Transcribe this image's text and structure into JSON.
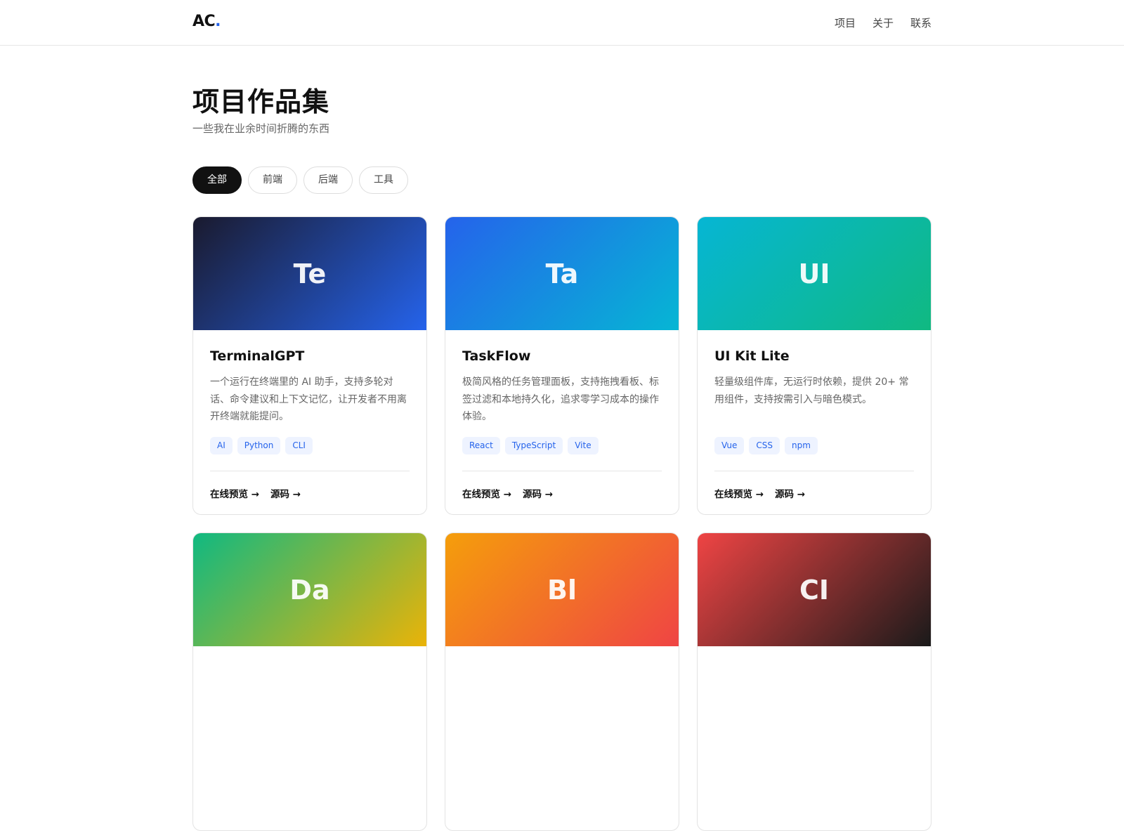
{
  "header": {
    "logo_text": "AC",
    "logo_dot": ".",
    "nav": [
      "项目",
      "关于",
      "联系"
    ]
  },
  "hero": {
    "title": "项目作品集",
    "subtitle": "一些我在业余时间折腾的东西"
  },
  "filters": {
    "items": [
      "全部",
      "前端",
      "后端",
      "工具"
    ],
    "active": "全部"
  },
  "link_labels": {
    "preview": "在线预览 →",
    "source": "源码 →"
  },
  "colors": {
    "accent": "#2563eb",
    "tag_bg": "#eef3ff"
  },
  "projects": [
    {
      "initials": "Te",
      "title": "TerminalGPT",
      "desc": "一个运行在终端里的 AI 助手，支持多轮对话、命令建议和上下文记忆，让开发者不用离开终端就能提问。",
      "tags": [
        "AI",
        "Python",
        "CLI"
      ],
      "gradient": [
        "#1a1a2e",
        "#2563eb"
      ]
    },
    {
      "initials": "Ta",
      "title": "TaskFlow",
      "desc": "极简风格的任务管理面板，支持拖拽看板、标签过滤和本地持久化，追求零学习成本的操作体验。",
      "tags": [
        "React",
        "TypeScript",
        "Vite"
      ],
      "gradient": [
        "#2563eb",
        "#06b6d4"
      ]
    },
    {
      "initials": "UI",
      "title": "UI Kit Lite",
      "desc": "轻量级组件库，无运行时依赖，提供 20+ 常用组件，支持按需引入与暗色模式。",
      "tags": [
        "Vue",
        "CSS",
        "npm"
      ],
      "gradient": [
        "#06b6d4",
        "#10b981"
      ]
    },
    {
      "initials": "Da",
      "title": "",
      "desc": "",
      "tags": [],
      "gradient": [
        "#10b981",
        "#eab308"
      ]
    },
    {
      "initials": "Bl",
      "title": "",
      "desc": "",
      "tags": [],
      "gradient": [
        "#f59e0b",
        "#ef4444"
      ]
    },
    {
      "initials": "CI",
      "title": "",
      "desc": "",
      "tags": [],
      "gradient": [
        "#ef4444",
        "#1a1a1a"
      ]
    }
  ]
}
